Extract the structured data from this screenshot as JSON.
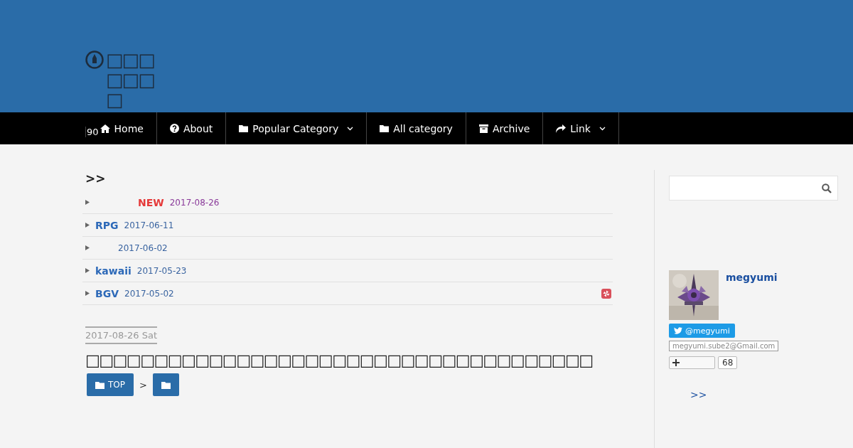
{
  "site": {
    "title": "□□□□□□□",
    "counter": "90"
  },
  "nav": [
    {
      "label": "Home",
      "kind": "home",
      "dropdown": false
    },
    {
      "label": "About",
      "kind": "help",
      "dropdown": false
    },
    {
      "label": "Popular Category",
      "kind": "folder",
      "dropdown": true
    },
    {
      "label": "All category",
      "kind": "folder",
      "dropdown": false
    },
    {
      "label": "Archive",
      "kind": "archive",
      "dropdown": false
    },
    {
      "label": "Link",
      "kind": "share",
      "dropdown": true
    }
  ],
  "recent": {
    "heading": ">>",
    "items": [
      {
        "new": true,
        "badge": "NEW",
        "date": "2017-08-26"
      },
      {
        "title": "RPG",
        "new": false,
        "date": "2017-06-11"
      },
      {
        "new": false,
        "date": "2017-06-02"
      },
      {
        "title": "kawaii",
        "new": false,
        "date": "2017-05-23"
      },
      {
        "title": "BGV",
        "new": false,
        "date": "2017-05-02"
      }
    ]
  },
  "article": {
    "date": "2017-08-26 Sat",
    "title": "□□□□□□□□□□□□□□□□□□□□□□□□□□□□□□□□□□□□□",
    "breadcrumbs": [
      {
        "label": "TOP",
        "kind": "folder"
      },
      {
        "kind": "folder"
      }
    ],
    "separator": ">"
  },
  "sidebar": {
    "profile": {
      "name": "megyumi",
      "twitter": "@megyumi",
      "email": "megyumi.sube2@Gmail.com",
      "follow_count": "68"
    },
    "more_link": ">>"
  }
}
